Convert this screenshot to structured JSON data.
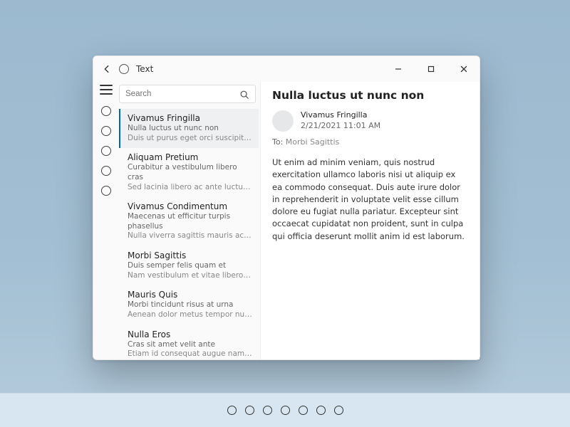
{
  "window": {
    "title": "Text",
    "search_placeholder": "Search"
  },
  "list": [
    {
      "title": "Vivamus Fringilla",
      "line1": "Nulla luctus ut nunc non",
      "line2": "Duis ut purus eget orci suscipit malesuada",
      "selected": true
    },
    {
      "title": "Aliquam Pretium",
      "line1": "Curabitur a vestibulum libero cras",
      "line2": "Sed lacinia libero ac ante luctus nec interdum",
      "selected": false
    },
    {
      "title": "Vivamus Condimentum",
      "line1": "Maecenas ut efficitur turpis phasellus",
      "line2": "Nulla viverra sagittis mauris ac convallis",
      "selected": false
    },
    {
      "title": "Morbi Sagittis",
      "line1": "Duis semper felis quam et",
      "line2": "Nam vestibulum et vitae libero finibus et",
      "selected": false
    },
    {
      "title": "Mauris Quis",
      "line1": "Morbi tincidunt risus at urna",
      "line2": "Aenean dolor metus tempor nulla ac dapibus",
      "selected": false
    },
    {
      "title": "Nulla Eros",
      "line1": "Cras sit amet velit ante",
      "line2": "Etiam id consequat augue nam tincidunt",
      "selected": false
    }
  ],
  "detail": {
    "subject": "Nulla luctus ut nunc non",
    "from": "Vivamus Fringilla",
    "date": "2/21/2021 11:01 AM",
    "to_label": "To:",
    "to_value": "Morbi Sagittis",
    "body": "Ut enim ad minim veniam, quis nostrud exercitation ullamco laboris nisi ut aliquip ex ea commodo consequat. Duis aute irure dolor in reprehenderit in voluptate velit esse cillum dolore eu fugiat nulla pariatur. Excepteur sint occaecat cupidatat non proident, sunt in culpa qui officia deserunt mollit anim id est laborum."
  },
  "nav_dots": 5,
  "bottom_dots": 7
}
